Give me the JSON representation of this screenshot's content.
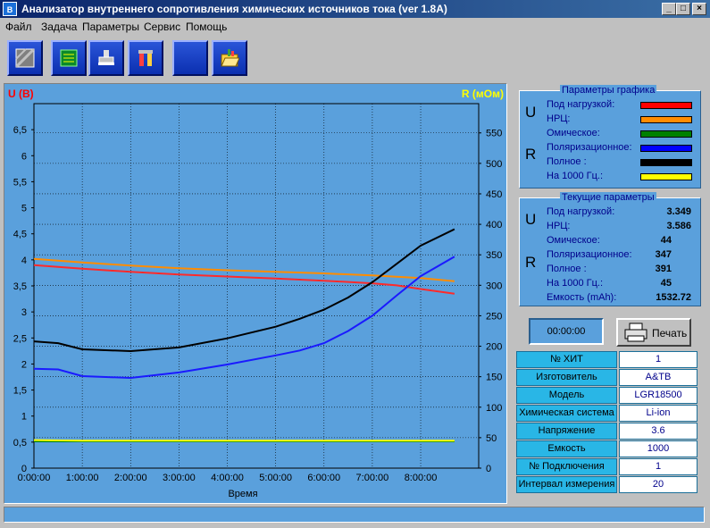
{
  "window": {
    "title": "Анализатор внутреннего сопротивления химических источников тока (ver 1.8A)",
    "icon_text": "B",
    "min_label": "_",
    "max_label": "□",
    "close_label": "×"
  },
  "menu": [
    "Файл",
    "Задача",
    "Параметры",
    "Сервис",
    "Помощь"
  ],
  "toolbar": [
    "tool-grid-icon",
    "chip-icon",
    "stamp-icon",
    "tools-icon",
    "blank",
    "folder-open-icon"
  ],
  "legend_panel": {
    "title": "Параметры графика",
    "u_letter": "U",
    "r_letter": "R",
    "items": [
      {
        "label": "Под нагрузкой:",
        "color": "#ff0000"
      },
      {
        "label": "НРЦ:",
        "color": "#ff8c00"
      },
      {
        "label": "Омическое:",
        "color": "#008000"
      },
      {
        "label": "Поляризационное:",
        "color": "#0000ff"
      },
      {
        "label": "Полное :",
        "color": "#000000"
      },
      {
        "label": "На 1000 Гц.:",
        "color": "#ffff00"
      }
    ]
  },
  "current_panel": {
    "title": "Текущие параметры",
    "u_letter": "U",
    "r_letter": "R",
    "items": [
      {
        "label": "Под нагрузкой:",
        "value": "3.349"
      },
      {
        "label": "НРЦ:",
        "value": "3.586"
      },
      {
        "label": "Омическое:",
        "value": "44"
      },
      {
        "label": "Поляризационное:",
        "value": "347"
      },
      {
        "label": "Полное :",
        "value": "391"
      },
      {
        "label": "На 1000 Гц.:",
        "value": "45"
      },
      {
        "label": "Емкость (mAh):",
        "value": "1532.72"
      }
    ]
  },
  "timer": "00:00:00",
  "print_button": "Печать",
  "info_table": [
    {
      "label": "№ ХИТ",
      "value": "1"
    },
    {
      "label": "Изготовитель",
      "value": "A&TB"
    },
    {
      "label": "Модель",
      "value": "LGR18500"
    },
    {
      "label": "Химическая система",
      "value": "Li-ion"
    },
    {
      "label": "Напряжение",
      "value": "3.6"
    },
    {
      "label": "Емкость",
      "value": "1000"
    },
    {
      "label": "№ Подключения",
      "value": "1"
    },
    {
      "label": "Интервал измерения",
      "value": "20"
    }
  ],
  "chart_data": {
    "type": "line",
    "left_axis_label": "U (В)",
    "right_axis_label": "R (мОм)",
    "xlabel": "Время",
    "x_ticks": [
      "0:00:00",
      "1:00:00",
      "2:00:00",
      "3:00:00",
      "4:00:00",
      "5:00:00",
      "6:00:00",
      "7:00:00",
      "8:00:00"
    ],
    "x_range_hours": [
      0,
      9.2
    ],
    "y_left_ticks": [
      "0",
      "0,5",
      "1",
      "1,5",
      "2",
      "2,5",
      "3",
      "3,5",
      "4",
      "4,5",
      "5",
      "5,5",
      "6",
      "6,5"
    ],
    "y_left_range": [
      0,
      7.0
    ],
    "y_right_ticks": [
      "0",
      "50",
      "100",
      "150",
      "200",
      "250",
      "300",
      "350",
      "400",
      "450",
      "500",
      "550"
    ],
    "y_right_range": [
      0,
      598
    ],
    "grid": true,
    "background": "#5aa0dc",
    "series": [
      {
        "axis": "left",
        "color": "#ff2a2a",
        "x": [
          0,
          1,
          2,
          3,
          4,
          5,
          6,
          7,
          7.5,
          8,
          8.7
        ],
        "y": [
          3.9,
          3.83,
          3.77,
          3.72,
          3.68,
          3.64,
          3.6,
          3.55,
          3.51,
          3.44,
          3.35
        ]
      },
      {
        "axis": "left",
        "color": "#ff8c00",
        "x": [
          0,
          1,
          2,
          3,
          4,
          5,
          6,
          7,
          8,
          8.7
        ],
        "y": [
          4.02,
          3.95,
          3.89,
          3.84,
          3.8,
          3.77,
          3.74,
          3.7,
          3.65,
          3.59
        ]
      },
      {
        "axis": "right",
        "color": "#000000",
        "x": [
          0,
          0.5,
          1,
          2,
          3,
          4,
          5,
          5.5,
          6,
          6.5,
          7,
          7.5,
          8,
          8.7
        ],
        "y": [
          208,
          205,
          195,
          192,
          198,
          213,
          232,
          245,
          260,
          280,
          305,
          335,
          365,
          392
        ]
      },
      {
        "axis": "right",
        "color": "#1a1aff",
        "x": [
          0,
          0.5,
          1,
          2,
          3,
          4,
          5,
          5.5,
          6,
          6.5,
          7,
          7.5,
          8,
          8.7
        ],
        "y": [
          163,
          162,
          151,
          148,
          157,
          170,
          185,
          193,
          205,
          225,
          250,
          283,
          315,
          347
        ]
      },
      {
        "axis": "right",
        "color": "#008000",
        "x": [
          0,
          1,
          2,
          3,
          4,
          5,
          6,
          7,
          8,
          8.7
        ],
        "y": [
          44,
          44,
          44,
          44,
          44,
          44,
          44,
          44,
          44,
          44
        ]
      },
      {
        "axis": "right",
        "color": "#ffff00",
        "x": [
          0,
          1,
          2,
          3,
          4,
          5,
          6,
          7,
          8,
          8.7
        ],
        "y": [
          46,
          45,
          45,
          45,
          45,
          45,
          45,
          45,
          45,
          45
        ]
      }
    ]
  }
}
